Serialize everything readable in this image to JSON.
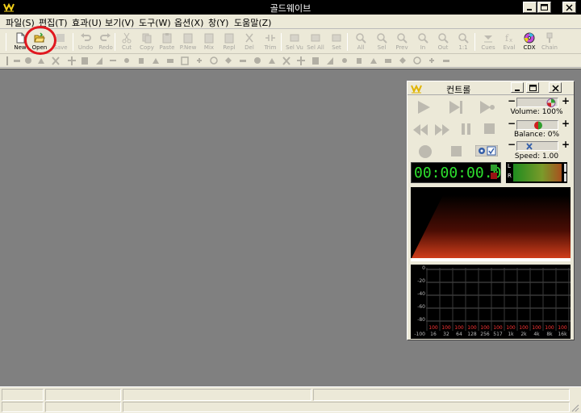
{
  "window": {
    "title": "골드웨이브"
  },
  "menu": [
    "파일(S)",
    "편집(T)",
    "효과(U)",
    "보기(V)",
    "도구(W)",
    "옵션(X)",
    "창(Y)",
    "도움말(Z)"
  ],
  "toolbar": [
    {
      "label": "New",
      "icon": "new-file-icon",
      "enabled": true
    },
    {
      "label": "Open",
      "icon": "open-folder-icon",
      "enabled": true
    },
    {
      "label": "Save",
      "icon": "save-icon",
      "enabled": false
    },
    {
      "label": "Undo",
      "icon": "undo-icon",
      "enabled": false
    },
    {
      "label": "Redo",
      "icon": "redo-icon",
      "enabled": false
    },
    {
      "label": "Cut",
      "icon": "cut-icon",
      "enabled": false
    },
    {
      "label": "Copy",
      "icon": "copy-icon",
      "enabled": false
    },
    {
      "label": "Paste",
      "icon": "paste-icon",
      "enabled": false
    },
    {
      "label": "P.New",
      "icon": "paste-new-icon",
      "enabled": false
    },
    {
      "label": "Mix",
      "icon": "mix-icon",
      "enabled": false
    },
    {
      "label": "Repl",
      "icon": "replace-icon",
      "enabled": false
    },
    {
      "label": "Del",
      "icon": "delete-icon",
      "enabled": false
    },
    {
      "label": "Trim",
      "icon": "trim-icon",
      "enabled": false
    },
    {
      "label": "Sel Vu",
      "icon": "select-view-icon",
      "enabled": false
    },
    {
      "label": "Sel All",
      "icon": "select-all-icon",
      "enabled": false
    },
    {
      "label": "Set",
      "icon": "set-icon",
      "enabled": false
    },
    {
      "label": "All",
      "icon": "zoom-all-icon",
      "enabled": false
    },
    {
      "label": "Sel",
      "icon": "zoom-selection-icon",
      "enabled": false
    },
    {
      "label": "Prev",
      "icon": "zoom-previous-icon",
      "enabled": false
    },
    {
      "label": "In",
      "icon": "zoom-in-icon",
      "enabled": false
    },
    {
      "label": "Out",
      "icon": "zoom-out-icon",
      "enabled": false
    },
    {
      "label": "1:1",
      "icon": "zoom-1-1-icon",
      "enabled": false
    },
    {
      "label": "Cues",
      "icon": "cues-icon",
      "enabled": false
    },
    {
      "label": "Eval",
      "icon": "evaluate-icon",
      "enabled": false
    },
    {
      "label": "CDX",
      "icon": "cd-extract-icon",
      "enabled": true
    },
    {
      "label": "Chain",
      "icon": "chain-icon",
      "enabled": false
    }
  ],
  "control": {
    "title": "컨트롤",
    "volume_label": "Volume: 100%",
    "balance_label": "Balance: 0%",
    "speed_label": "Speed: 1.00",
    "time": "00:00:00.0",
    "channel_left": "L",
    "channel_right": "R",
    "eq": {
      "y_labels": [
        "0",
        "-20",
        "-40",
        "-60",
        "-80",
        "-100"
      ],
      "x_labels": [
        "16",
        "32",
        "64",
        "128",
        "256",
        "517",
        "1k",
        "2k",
        "4k",
        "8k",
        "16k"
      ],
      "values": [
        "100",
        "100",
        "100",
        "100",
        "100",
        "100",
        "100",
        "100",
        "100",
        "100",
        "100"
      ]
    },
    "colors": {
      "time": "#2ee02e",
      "eq_values": "#ff3535"
    }
  },
  "colors": {
    "workspace": "#808080",
    "highlight_circle": "#e0181f"
  }
}
